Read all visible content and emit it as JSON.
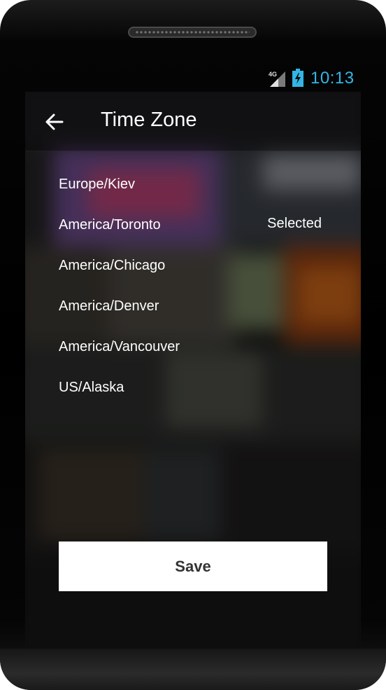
{
  "status_bar": {
    "network": "4G",
    "time": "10:13",
    "signal_icon": "cell-signal-icon",
    "battery_icon": "battery-charging-icon",
    "accent_color": "#33b5e5"
  },
  "app_bar": {
    "back_icon": "arrow-back-icon",
    "title": "Time Zone"
  },
  "time_zones": [
    {
      "label": "Europe/Kiev",
      "selected_text": ""
    },
    {
      "label": "America/Toronto",
      "selected_text": "Selected"
    },
    {
      "label": "America/Chicago",
      "selected_text": ""
    },
    {
      "label": "America/Denver",
      "selected_text": ""
    },
    {
      "label": "America/Vancouver",
      "selected_text": ""
    },
    {
      "label": "US/Alaska",
      "selected_text": ""
    }
  ],
  "save_label": "Save"
}
